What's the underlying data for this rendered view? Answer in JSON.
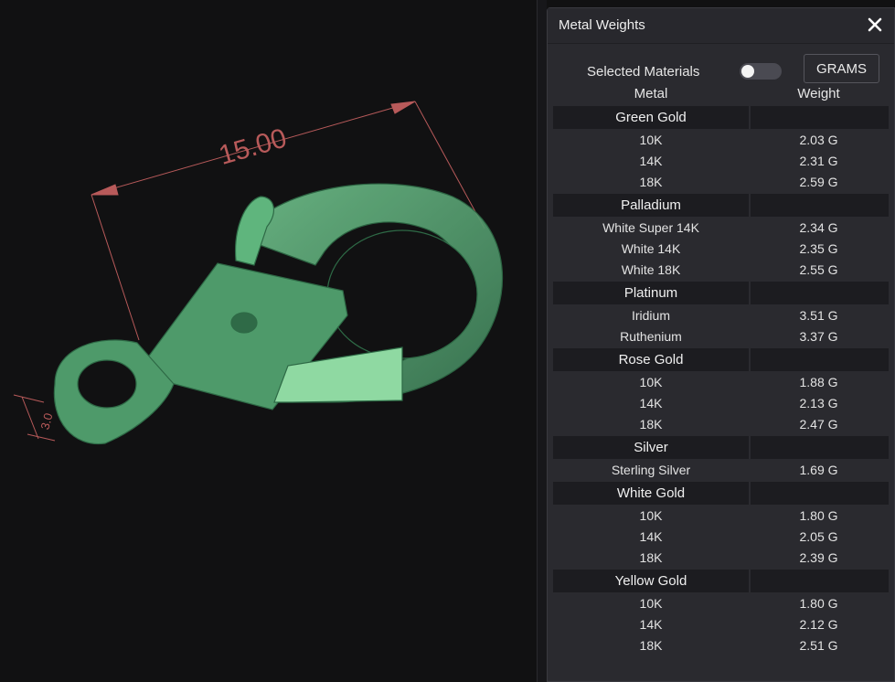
{
  "viewport": {
    "dimension_main": "15.00",
    "dimension_side": "3.0"
  },
  "panel": {
    "title": "Metal Weights",
    "close_icon": "close-icon",
    "selected_materials_label": "Selected Materials",
    "selected_materials_on": false,
    "units_button": "GRAMS",
    "col_metal": "Metal",
    "col_weight": "Weight",
    "groups": [
      {
        "name": "Green Gold",
        "rows": [
          {
            "metal": "10K",
            "weight": "2.03 G"
          },
          {
            "metal": "14K",
            "weight": "2.31 G"
          },
          {
            "metal": "18K",
            "weight": "2.59 G"
          }
        ]
      },
      {
        "name": "Palladium",
        "rows": [
          {
            "metal": "White Super 14K",
            "weight": "2.34 G"
          },
          {
            "metal": "White 14K",
            "weight": "2.35 G"
          },
          {
            "metal": "White 18K",
            "weight": "2.55 G"
          }
        ]
      },
      {
        "name": "Platinum",
        "rows": [
          {
            "metal": "Iridium",
            "weight": "3.51 G"
          },
          {
            "metal": "Ruthenium",
            "weight": "3.37 G"
          }
        ]
      },
      {
        "name": "Rose Gold",
        "rows": [
          {
            "metal": "10K",
            "weight": "1.88 G"
          },
          {
            "metal": "14K",
            "weight": "2.13 G"
          },
          {
            "metal": "18K",
            "weight": "2.47 G"
          }
        ]
      },
      {
        "name": "Silver",
        "rows": [
          {
            "metal": "Sterling Silver",
            "weight": "1.69 G"
          }
        ]
      },
      {
        "name": "White Gold",
        "rows": [
          {
            "metal": "10K",
            "weight": "1.80 G"
          },
          {
            "metal": "14K",
            "weight": "2.05 G"
          },
          {
            "metal": "18K",
            "weight": "2.39 G"
          }
        ]
      },
      {
        "name": "Yellow Gold",
        "rows": [
          {
            "metal": "10K",
            "weight": "1.80 G"
          },
          {
            "metal": "14K",
            "weight": "2.12 G"
          },
          {
            "metal": "18K",
            "weight": "2.51 G"
          }
        ]
      }
    ]
  }
}
